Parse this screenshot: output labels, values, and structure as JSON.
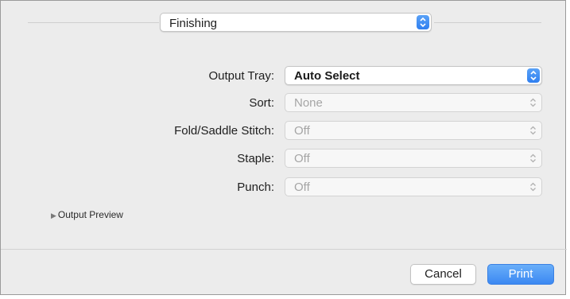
{
  "pane_selector": {
    "value": "Finishing"
  },
  "form": {
    "rows": [
      {
        "label": "Output Tray:",
        "value": "Auto Select"
      },
      {
        "label": "Sort:",
        "value": "None"
      },
      {
        "label": "Fold/Saddle Stitch:",
        "value": "Off"
      },
      {
        "label": "Staple:",
        "value": "Off"
      },
      {
        "label": "Punch:",
        "value": "Off"
      }
    ]
  },
  "output_preview": {
    "label": "Output Preview"
  },
  "buttons": {
    "cancel": "Cancel",
    "print": "Print"
  },
  "colors": {
    "accent": "#3b88f2",
    "window_bg": "#ececec",
    "disabled_text": "#a5a5a5"
  },
  "icons": {
    "popup_stepper": "up-down-arrows-icon",
    "disclosure": "disclosure-triangle-icon"
  }
}
